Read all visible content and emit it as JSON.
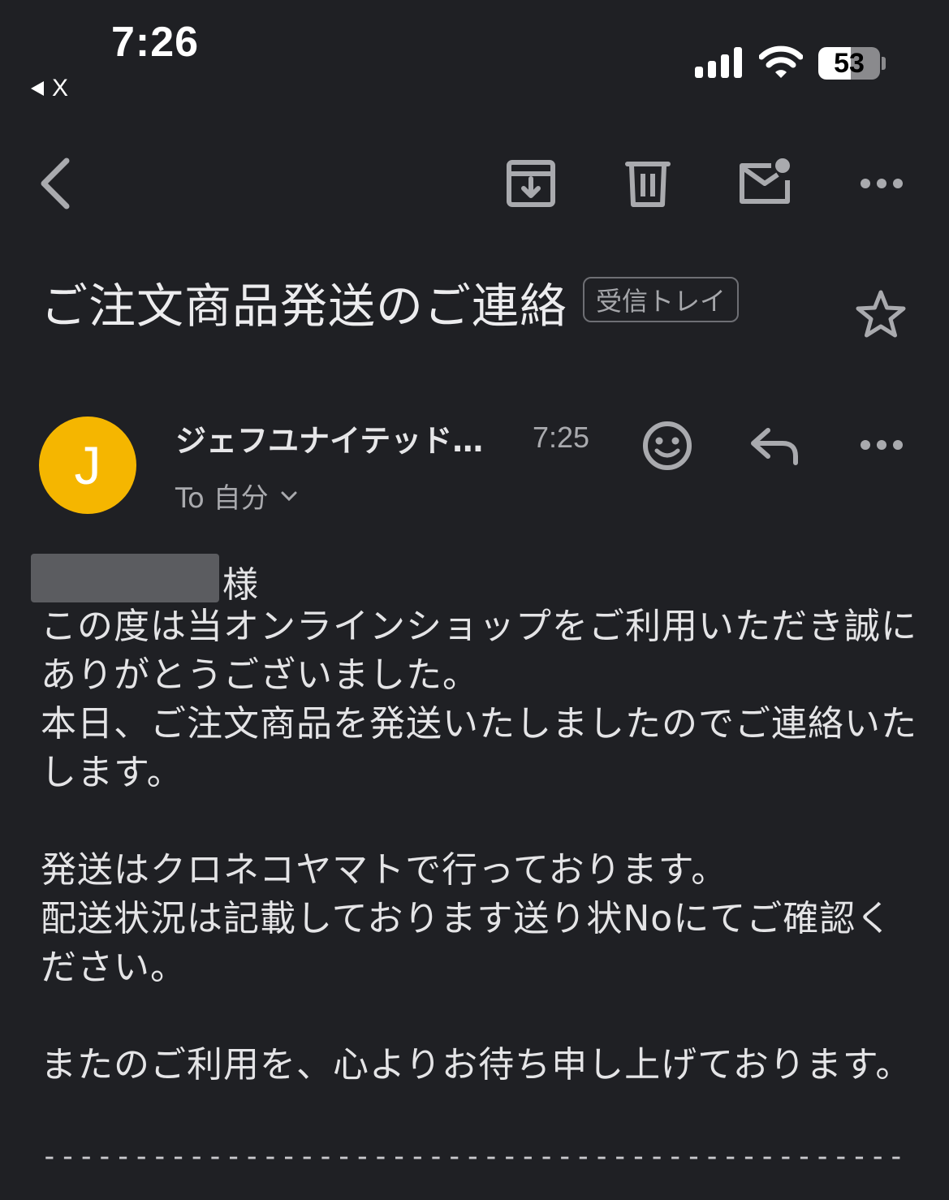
{
  "status_bar": {
    "time": "7:26",
    "back_app": "X",
    "battery_level": "53",
    "battery_fraction": 0.53
  },
  "toolbar": {
    "back_icon": "chevron-left-icon",
    "archive_icon": "archive-icon",
    "delete_icon": "trash-icon",
    "unread_icon": "mail-unread-icon",
    "more_icon": "more-horizontal-icon"
  },
  "email": {
    "subject": "ご注文商品発送のご連絡",
    "label": "受信トレイ",
    "starred": false,
    "sender": {
      "avatar_letter": "J",
      "avatar_color": "#f5b600",
      "name": "ジェフユナイテッド…",
      "time": "7:25",
      "recipient": "To 自分"
    },
    "body": {
      "salutation": "様",
      "paragraph1_line1": "この度は当オンラインショップをご利用いただき誠にありがとうございました。",
      "paragraph1_line2": "本日、ご注文商品を発送いたしましたのでご連絡いたします。",
      "paragraph2_line1": "発送はクロネコヤマトで行っております。",
      "paragraph2_line2": "配送状況は記載しております送り状Noにてご確認ください。",
      "paragraph3_line1": "またのご利用を、心よりお待ち申し上げております。",
      "divider": "------------------------------------------------------------------------"
    }
  },
  "colors": {
    "background": "#1f2024",
    "text": "#e4e4e6",
    "muted": "#a9aaae",
    "avatar": "#f5b600"
  }
}
